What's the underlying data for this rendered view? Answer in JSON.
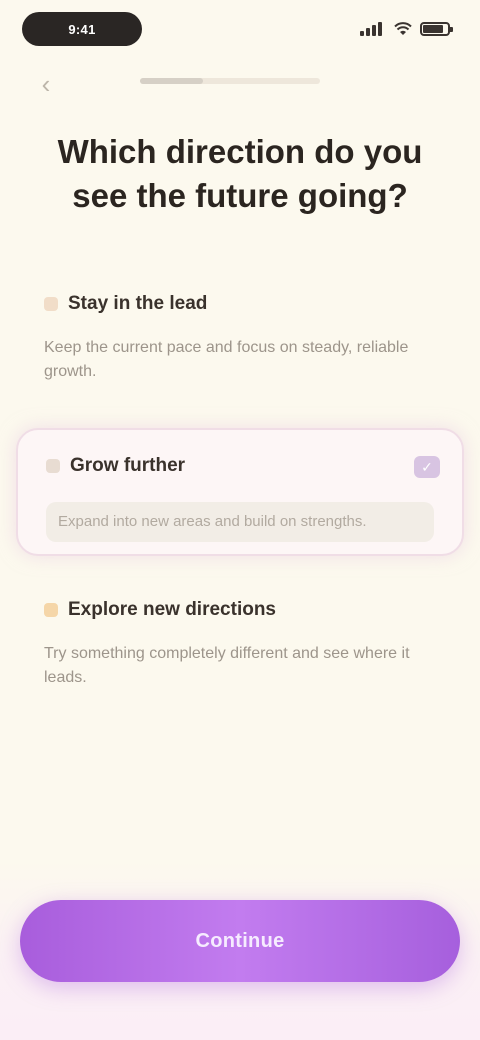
{
  "status_bar": {
    "time": "9:41",
    "signal_icon": "signal-icon",
    "wifi_icon": "wifi-icon",
    "battery_icon": "battery-icon",
    "battery_level": 0.85
  },
  "header": {
    "back_icon": "chevron-left-icon",
    "back_glyph": "‹",
    "progress": 0.35
  },
  "title": "Which direction do you see the future going?",
  "options": [
    {
      "title": "Stay in the lead",
      "description": "Keep the current pace and focus on steady, reliable growth."
    },
    {
      "title": "Grow further",
      "description": "Expand into new areas and build on strengths.",
      "selected": true,
      "check_glyph": "✓"
    },
    {
      "title": "Explore new directions",
      "description": "Try something completely different and see where it leads."
    }
  ],
  "cta": {
    "label": "Continue"
  },
  "colors": {
    "background": "#fcf9ee",
    "accent": "#b16ae4",
    "selected_border": "#f0dde6"
  }
}
